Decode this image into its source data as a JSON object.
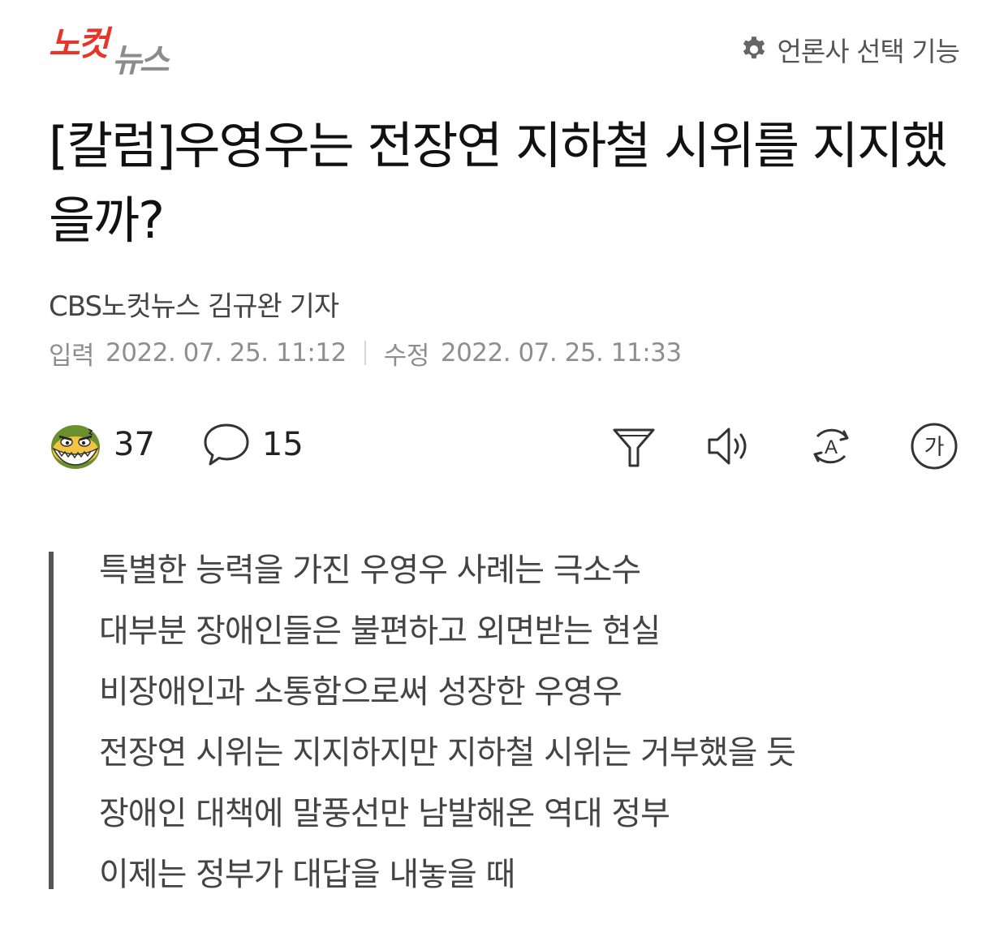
{
  "header": {
    "logo": {
      "text_red": "노컷",
      "text_gray": "뉴스",
      "red": "#e8352b",
      "gray": "#8c8c8c"
    },
    "press_select": {
      "icon": "gear-icon",
      "label": "언론사 선택 기능"
    }
  },
  "article": {
    "title": "[칼럼]우영우는 전장연 지하철 시위를 지지했을까?",
    "byline": "CBS노컷뉴스 김규완 기자",
    "input_label": "입력",
    "input_date": "2022. 07. 25. 11:12",
    "modified_label": "수정",
    "modified_date": "2022. 07. 25. 11:33"
  },
  "stats": {
    "reaction_icon": "nocut-mascot-icon",
    "reactions": "37",
    "comment_icon": "speech-bubble-icon",
    "comments": "15"
  },
  "tools": [
    "filter-funnel-icon",
    "speaker-icon",
    "translate-icon",
    "font-size-icon"
  ],
  "font_tool_label": "가",
  "translate_tool_label": "A",
  "summary": [
    "특별한 능력을 가진 우영우 사례는 극소수",
    "대부분 장애인들은 불편하고 외면받는 현실",
    "비장애인과 소통함으로써 성장한 우영우",
    "전장연 시위는 지지하지만 지하철 시위는 거부했을 듯",
    "장애인 대책에 말풍선만 남발해온 역대 정부",
    "이제는 정부가 대답을 내놓을 때"
  ]
}
